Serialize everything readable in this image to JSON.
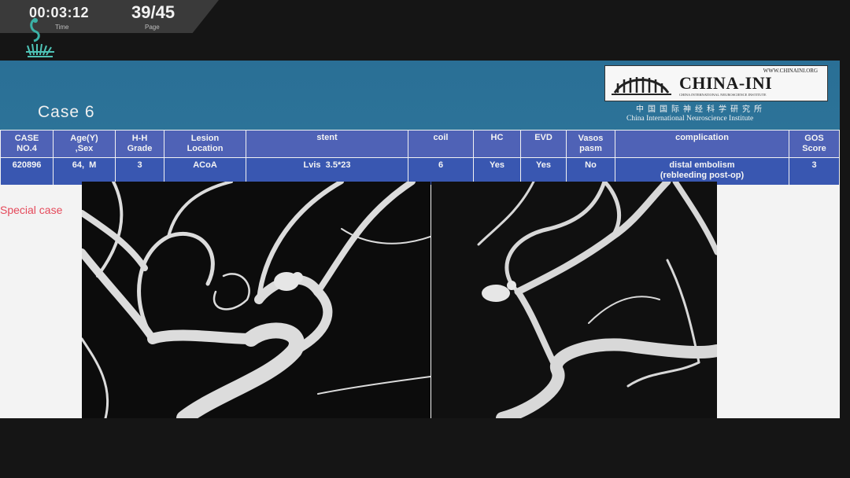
{
  "player": {
    "time_value": "00:03:12",
    "time_label": "Time",
    "page_value": "39/45",
    "page_label": "Page"
  },
  "slide": {
    "title": "Case 6",
    "special_case_label": "Special case",
    "logo": {
      "url": "WWW.CHINAINI.ORG",
      "name": "CHINA-INI",
      "subtitle": "CHINA INTERNATIONAL NEUROSCIENCE INSTITUTE",
      "chinese": "中国国际神经科学研究所",
      "english": "China International Neuroscience Institute"
    },
    "table": {
      "headers": [
        [
          "CASE",
          "NO.4"
        ],
        [
          "Age(Y)",
          ",Sex"
        ],
        [
          "H-H",
          "Grade"
        ],
        [
          "Lesion",
          "Location"
        ],
        [
          "stent",
          ""
        ],
        [
          "coil",
          ""
        ],
        [
          "HC",
          ""
        ],
        [
          "EVD",
          ""
        ],
        [
          "Vasos",
          "pasm"
        ],
        [
          "complication",
          ""
        ],
        [
          "GOS",
          "Score"
        ]
      ],
      "row": [
        [
          "620896",
          ""
        ],
        [
          "64,  M",
          ""
        ],
        [
          "3",
          ""
        ],
        [
          "ACoA",
          ""
        ],
        [
          "Lvis  3.5*23",
          ""
        ],
        [
          "6",
          ""
        ],
        [
          "Yes",
          ""
        ],
        [
          "Yes",
          ""
        ],
        [
          "No",
          ""
        ],
        [
          "distal embolism",
          "(rebleeding post-op)"
        ],
        [
          "3",
          ""
        ]
      ]
    }
  },
  "colors": {
    "header_blue": "#2c7398",
    "table_header": "#4f62b6",
    "table_row": "#3957b1",
    "special_red": "#e54a5b"
  },
  "icons": [
    "player-logo-icon",
    "china-ini-building-icon"
  ]
}
